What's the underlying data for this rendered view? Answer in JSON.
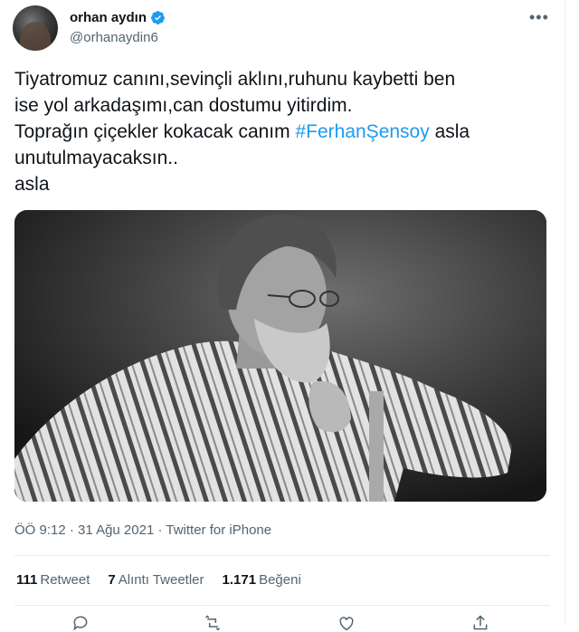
{
  "author": {
    "display_name": "orhan aydın",
    "handle": "@orhanaydin6",
    "verified": true
  },
  "tweet": {
    "lines": [
      {
        "text": "Tiyatromuz canını,sevinçli aklını,ruhunu kaybetti ben"
      },
      {
        "text": "ise yol arkadaşımı,can dostumu yitirdim."
      },
      {
        "before": "Toprağın çiçekler kokacak canım ",
        "hashtag": "#FerhanŞensoy",
        "after": " asla"
      },
      {
        "text": "unutulmayacaksın.."
      },
      {
        "text": "asla"
      }
    ]
  },
  "meta": {
    "time": "ÖÖ 9:12",
    "separator": " · ",
    "date": "31 Ağu 2021",
    "source": "Twitter for iPhone"
  },
  "stats": {
    "retweets": {
      "count": "111",
      "label": "Retweet"
    },
    "quotes": {
      "count": "7",
      "label": "Alıntı Tweetler"
    },
    "likes": {
      "count": "1.171",
      "label": "Beğeni"
    }
  },
  "icons": {
    "verified": "verified-badge-icon",
    "more": "more-horizontal-icon",
    "reply": "reply-icon",
    "retweet": "retweet-icon",
    "like": "heart-icon",
    "share": "share-icon"
  },
  "colors": {
    "accent": "#1d9bf0",
    "secondary_text": "#536471",
    "primary_text": "#0f1419"
  }
}
